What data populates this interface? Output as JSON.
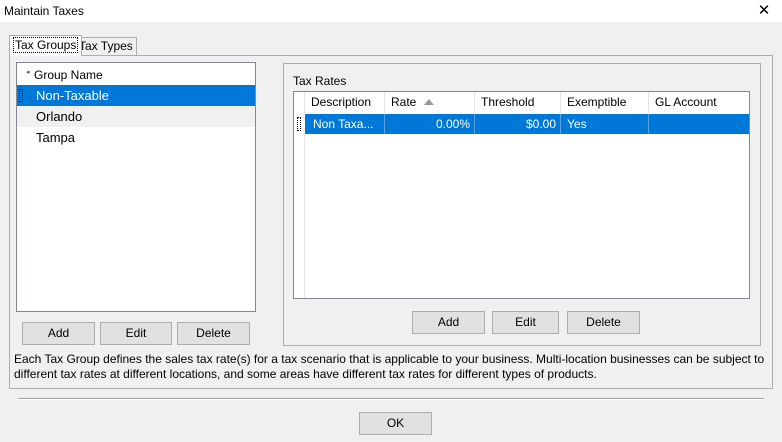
{
  "window": {
    "title": "Maintain Taxes",
    "close_glyph": "✕"
  },
  "tabs": [
    {
      "label": "Tax Groups",
      "active": true
    },
    {
      "label": "Tax Types",
      "active": false
    }
  ],
  "groups": {
    "header": "Group Name",
    "items": [
      {
        "label": "Non-Taxable",
        "selected": true
      },
      {
        "label": "Orlando",
        "selected": false
      },
      {
        "label": "Tampa",
        "selected": false
      }
    ],
    "buttons": {
      "add": "Add",
      "edit": "Edit",
      "delete": "Delete"
    }
  },
  "tax_rates": {
    "title": "Tax Rates",
    "columns": [
      "Description",
      "Rate",
      "Threshold",
      "Exemptible",
      "GL Account"
    ],
    "sorted_column": "Rate",
    "rows": [
      {
        "description": "Non Taxa...",
        "rate": "0.00%",
        "threshold": "$0.00",
        "exemptible": "Yes",
        "gl_account": ""
      }
    ],
    "buttons": {
      "add": "Add",
      "edit": "Edit",
      "delete": "Delete"
    }
  },
  "description": "Each Tax Group defines the sales tax rate(s) for a tax scenario that is applicable to your business. Multi-location businesses can be subject to different tax rates at different locations, and some areas have different tax rates for different types of products.",
  "footer": {
    "ok_label": "OK"
  },
  "colors": {
    "selection": "#0078d7",
    "background": "#f0f0f0"
  }
}
